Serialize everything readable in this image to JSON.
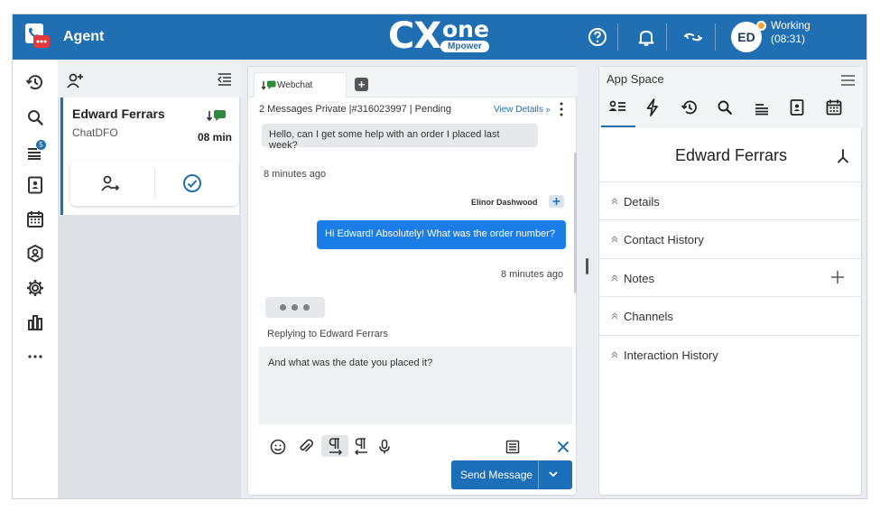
{
  "topbar": {
    "app_label": "Agent",
    "logo_main": "CX",
    "logo_one": "one",
    "logo_sub": "Mpower",
    "avatar_initials": "ED",
    "status_line1": "Working",
    "status_line2": "(08:31)",
    "colors": {
      "bar": "#1f6fb2",
      "status_dot": "#f2a63a"
    }
  },
  "leftnav": {
    "badge_count": "5",
    "icons": [
      "history-icon",
      "search-icon",
      "queue-icon",
      "contacts-book-icon",
      "calendar-icon",
      "user-badge-icon",
      "settings-icon",
      "reports-icon",
      "more-icon"
    ]
  },
  "contact_card": {
    "name": "Edward Ferrars",
    "skill": "ChatDFO",
    "elapsed": "08 min"
  },
  "chat": {
    "tab_label": "Webchat",
    "info": "2 Messages  Private  |#316023997 | Pending",
    "view_details": "View Details",
    "messages": [
      {
        "direction": "in",
        "text": "Hello, can I get some help with an order I placed last week?",
        "time": "8 minutes ago"
      },
      {
        "direction": "out",
        "sender": "Elinor Dashwood",
        "text": "Hi Edward! Absolutely! What was the order number?",
        "time": "8 minutes ago"
      }
    ],
    "replying_to": "Replying to Edward Ferrars",
    "draft": "And what was the date you placed it?",
    "send_label": "Send Message"
  },
  "appspace": {
    "title": "App Space",
    "customer_name": "Edward Ferrars",
    "sections": [
      "Details",
      "Contact History",
      "Notes",
      "Channels",
      "Interaction History"
    ]
  }
}
